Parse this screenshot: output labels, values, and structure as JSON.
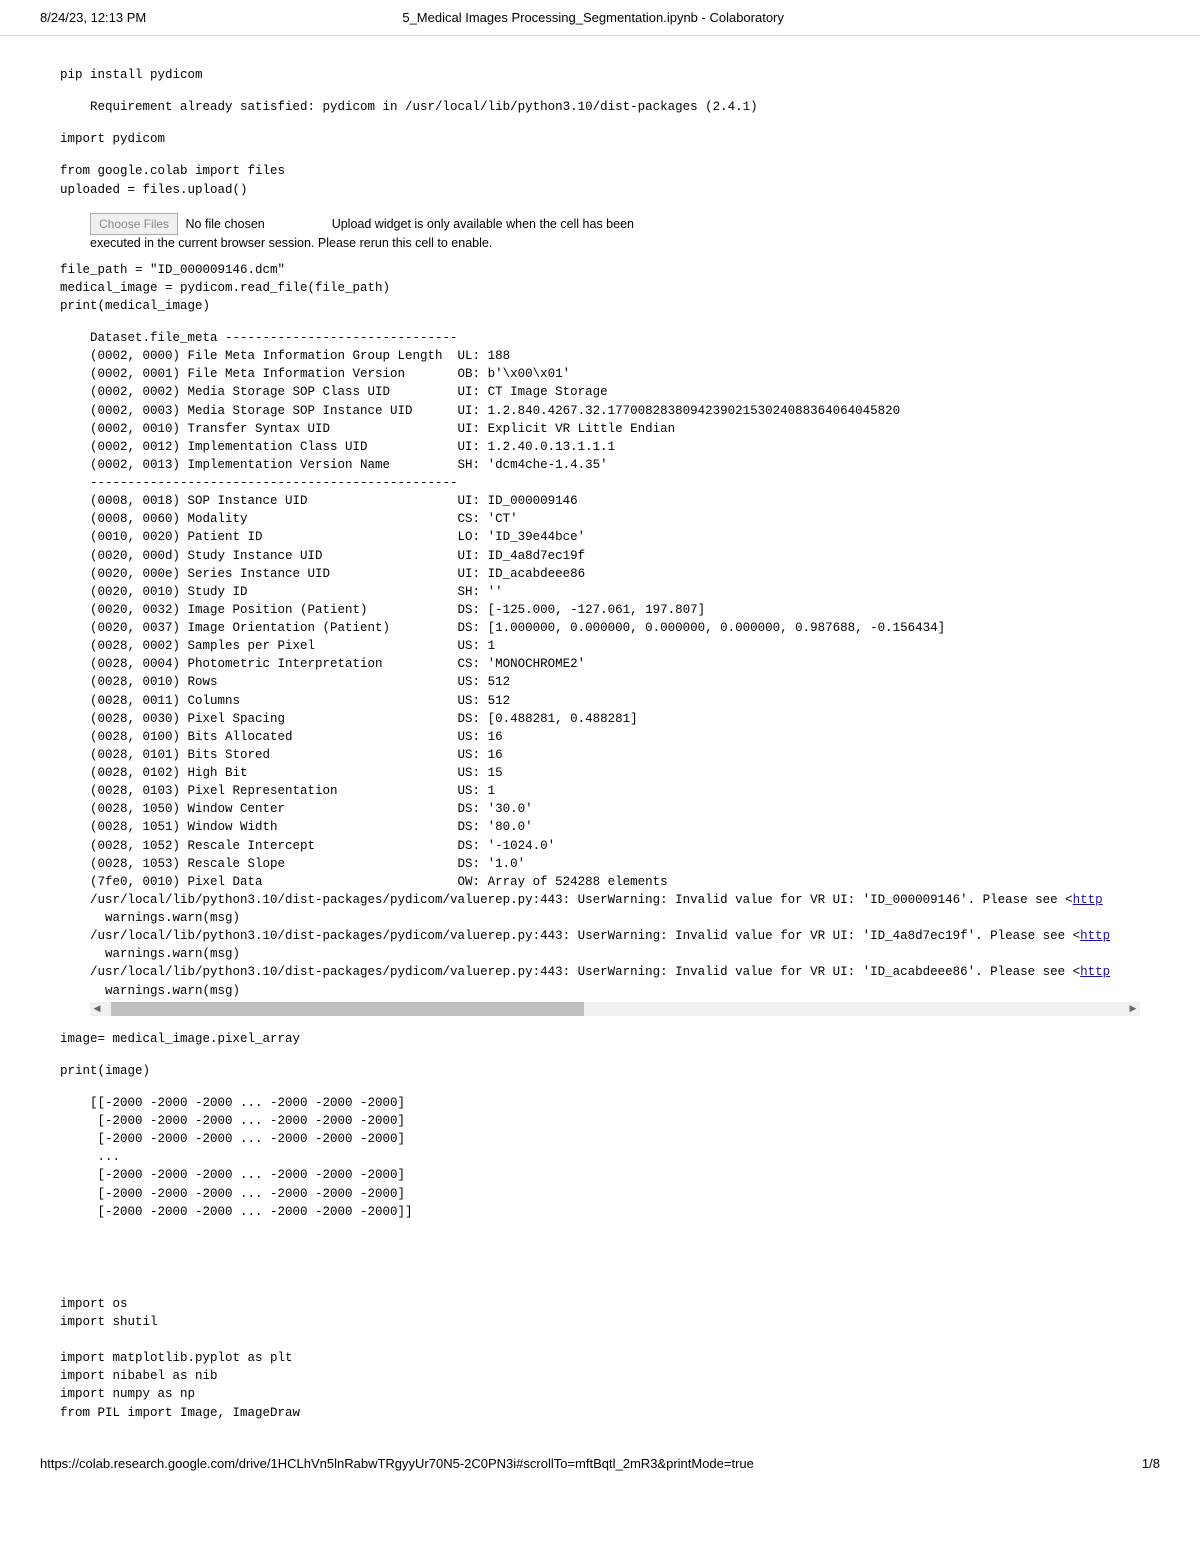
{
  "header": {
    "datetime": "8/24/23, 12:13 PM",
    "title": "5_Medical Images Processing_Segmentation.ipynb - Colaboratory"
  },
  "cells": {
    "pip_install": "pip install pydicom",
    "pip_output": "Requirement already satisfied: pydicom in /usr/local/lib/python3.10/dist-packages (2.4.1)",
    "import_pydicom": "import pydicom",
    "colab_upload": "from google.colab import files\nuploaded = files.upload()",
    "choose_files_btn": "Choose Files",
    "no_file_chosen": "No file chosen",
    "upload_widget_msg1": "Upload widget is only available when the cell has been",
    "upload_widget_msg2": "executed in the current browser session. Please rerun this cell to enable.",
    "read_dicom": "file_path = \"ID_000009146.dcm\"\nmedical_image = pydicom.read_file(file_path)\nprint(medical_image)",
    "pixel_array": "image= medical_image.pixel_array",
    "print_image": "print(image)",
    "print_image_out": "[[-2000 -2000 -2000 ... -2000 -2000 -2000]\n [-2000 -2000 -2000 ... -2000 -2000 -2000]\n [-2000 -2000 -2000 ... -2000 -2000 -2000]\n ...\n [-2000 -2000 -2000 ... -2000 -2000 -2000]\n [-2000 -2000 -2000 ... -2000 -2000 -2000]\n [-2000 -2000 -2000 ... -2000 -2000 -2000]]",
    "imports_block": "import os\nimport shutil\n\nimport matplotlib.pyplot as plt\nimport nibabel as nib\nimport numpy as np\nfrom PIL import Image, ImageDraw"
  },
  "dicom": {
    "meta_header": "Dataset.file_meta -------------------------------",
    "lines": [
      "(0002, 0000) File Meta Information Group Length  UL: 188",
      "(0002, 0001) File Meta Information Version       OB: b'\\x00\\x01'",
      "(0002, 0002) Media Storage SOP Class UID         UI: CT Image Storage",
      "(0002, 0003) Media Storage SOP Instance UID      UI: 1.2.840.4267.32.177008283809423902153024088364064045820",
      "(0002, 0010) Transfer Syntax UID                 UI: Explicit VR Little Endian",
      "(0002, 0012) Implementation Class UID            UI: 1.2.40.0.13.1.1.1",
      "(0002, 0013) Implementation Version Name         SH: 'dcm4che-1.4.35'",
      "-------------------------------------------------",
      "(0008, 0018) SOP Instance UID                    UI: ID_000009146",
      "(0008, 0060) Modality                            CS: 'CT'",
      "(0010, 0020) Patient ID                          LO: 'ID_39e44bce'",
      "(0020, 000d) Study Instance UID                  UI: ID_4a8d7ec19f",
      "(0020, 000e) Series Instance UID                 UI: ID_acabdeee86",
      "(0020, 0010) Study ID                            SH: ''",
      "(0020, 0032) Image Position (Patient)            DS: [-125.000, -127.061, 197.807]",
      "(0020, 0037) Image Orientation (Patient)         DS: [1.000000, 0.000000, 0.000000, 0.000000, 0.987688, -0.156434]",
      "(0028, 0002) Samples per Pixel                   US: 1",
      "(0028, 0004) Photometric Interpretation          CS: 'MONOCHROME2'",
      "(0028, 0010) Rows                                US: 512",
      "(0028, 0011) Columns                             US: 512",
      "(0028, 0030) Pixel Spacing                       DS: [0.488281, 0.488281]",
      "(0028, 0100) Bits Allocated                      US: 16",
      "(0028, 0101) Bits Stored                         US: 16",
      "(0028, 0102) High Bit                            US: 15",
      "(0028, 0103) Pixel Representation                US: 1",
      "(0028, 1050) Window Center                       DS: '30.0'",
      "(0028, 1051) Window Width                        DS: '80.0'",
      "(0028, 1052) Rescale Intercept                   DS: '-1024.0'",
      "(0028, 1053) Rescale Slope                       DS: '1.0'",
      "(7fe0, 0010) Pixel Data                          OW: Array of 524288 elements"
    ],
    "warn1_pre": "/usr/local/lib/python3.10/dist-packages/pydicom/valuerep.py:443: UserWarning: Invalid value for VR UI: 'ID_000009146'. Please see <",
    "warn2_pre": "/usr/local/lib/python3.10/dist-packages/pydicom/valuerep.py:443: UserWarning: Invalid value for VR UI: 'ID_4a8d7ec19f'. Please see <",
    "warn3_pre": "/usr/local/lib/python3.10/dist-packages/pydicom/valuerep.py:443: UserWarning: Invalid value for VR UI: 'ID_acabdeee86'. Please see <",
    "warn_link": "http",
    "warn_indent": "  warnings.warn(msg)"
  },
  "footer": {
    "url": "https://colab.research.google.com/drive/1HCLhVn5lnRabwTRgyyUr70N5-2C0PN3i#scrollTo=mftBqtl_2mR3&printMode=true",
    "page": "1/8"
  }
}
